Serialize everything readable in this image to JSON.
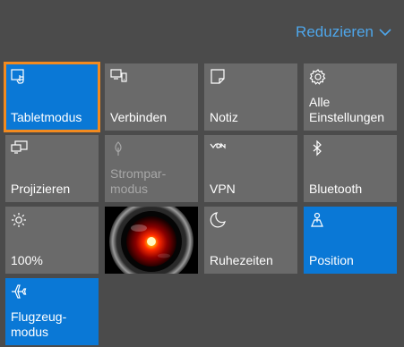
{
  "header": {
    "collapse_label": "Reduzieren"
  },
  "tiles": [
    {
      "label": "Tabletmodus",
      "icon": "tablet-mode-icon",
      "state": "active-focused"
    },
    {
      "label": "Verbinden",
      "icon": "connect-icon",
      "state": "off"
    },
    {
      "label": "Notiz",
      "icon": "note-icon",
      "state": "off"
    },
    {
      "label": "Alle\nEinstellungen",
      "icon": "gear-icon",
      "state": "off"
    },
    {
      "label": "Projizieren",
      "icon": "project-icon",
      "state": "off"
    },
    {
      "label": "Strompar-\nmodus",
      "icon": "battery-saver-icon",
      "state": "disabled"
    },
    {
      "label": "VPN",
      "icon": "vpn-icon",
      "state": "off"
    },
    {
      "label": "Bluetooth",
      "icon": "bluetooth-icon",
      "state": "off"
    },
    {
      "label": "100%",
      "icon": "brightness-icon",
      "state": "off"
    },
    {
      "label": "",
      "icon": "hal-eye-image",
      "state": "image"
    },
    {
      "label": "Ruhezeiten",
      "icon": "moon-icon",
      "state": "off"
    },
    {
      "label": "Position",
      "icon": "location-icon",
      "state": "active"
    },
    {
      "label": "Flugzeug-\nmodus",
      "icon": "airplane-icon",
      "state": "active"
    }
  ],
  "colors": {
    "accent": "#0a78d6",
    "tile": "#6a6a6a",
    "background": "#4b4b4b",
    "focus": "#f28a1f",
    "link": "#4ea6ea"
  }
}
